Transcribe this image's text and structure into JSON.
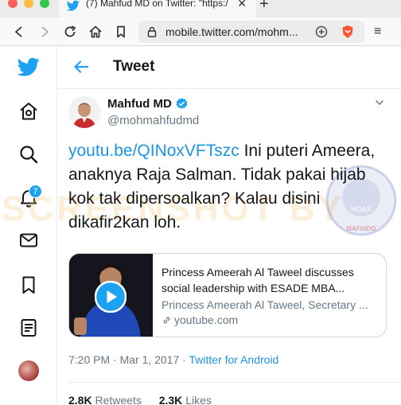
{
  "browser": {
    "tab_title": "(7) Mahfud MD on Twitter: \"https:/",
    "tab_close": "✕",
    "new_tab": "+",
    "url": "mobile.twitter.com/mohm...",
    "menu": "≡"
  },
  "sidebar": {
    "notifications_badge": "7"
  },
  "header": {
    "title": "Tweet"
  },
  "tweet": {
    "author_name": "Mahfud MD",
    "author_handle": "@mohmahfudmd",
    "link_text": "youtu.be/QINoxVFTszc",
    "body_text": " Ini puteri Ameera, anaknya Raja Salman. Tidak pakai hijab kok tak dipersoalkan? Kalau disini dikafir2kan loh.",
    "card": {
      "title": "Princess Ameerah Al Taweel discusses social leadership with ESADE MBA...",
      "description": "Princess Ameerah Al Taweel, Secretary ...",
      "domain": "youtube.com"
    },
    "time": "7:20 PM · Mar 1, 2017",
    "separator": " · ",
    "source": "Twitter for Android",
    "retweets_count": "2.8K",
    "retweets_label": "Retweets",
    "likes_count": "2.3K",
    "likes_label": "Likes"
  },
  "watermark": {
    "text": "SCREENSHOT BY",
    "seal_text": "HOAX",
    "seal_bottom": "MAFINDO"
  },
  "colors": {
    "twitter_blue": "#1da1f2",
    "link_blue": "#1b95e0",
    "muted_gray": "#657786",
    "border": "#e6ecf0"
  }
}
